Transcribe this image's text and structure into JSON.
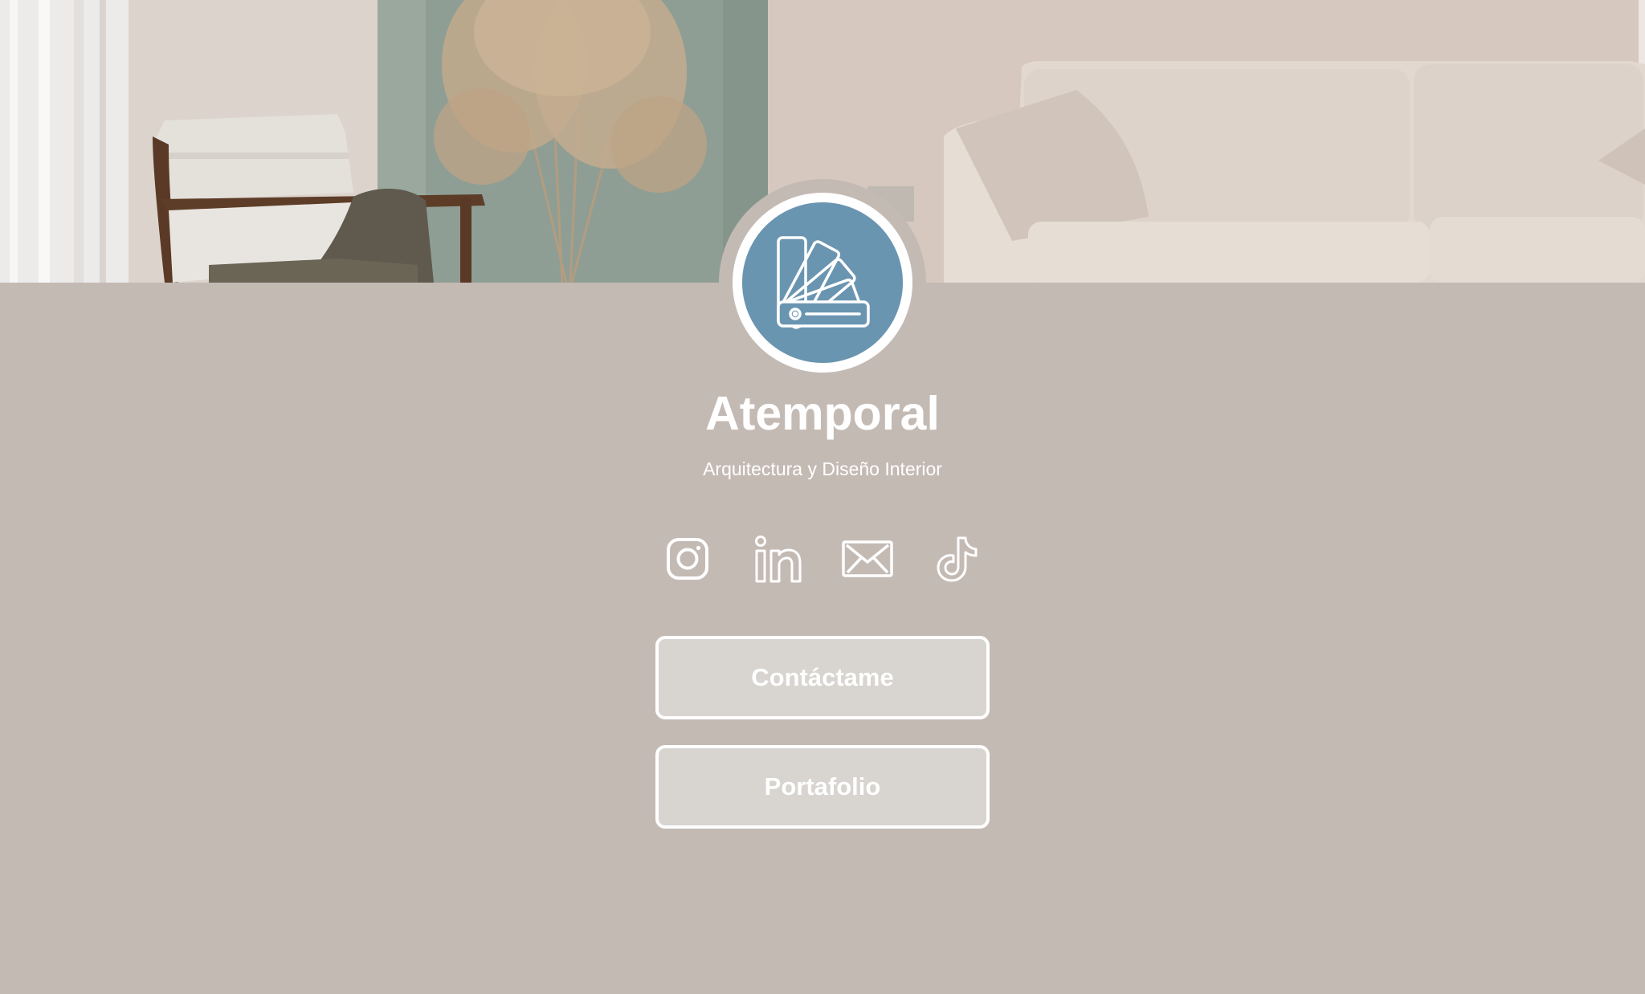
{
  "profile": {
    "name": "Atemporal",
    "tagline": "Arquitectura y Diseño Interior"
  },
  "socials": [
    {
      "icon": "instagram-icon"
    },
    {
      "icon": "linkedin-icon"
    },
    {
      "icon": "email-icon"
    },
    {
      "icon": "tiktok-icon"
    }
  ],
  "buttons": {
    "contact_label": "Contáctame",
    "portfolio_label": "Portafolio"
  },
  "avatar": {
    "icon": "color-swatch-fan-icon"
  },
  "colors": {
    "page_background": "#c4bab4",
    "avatar_background": "#6a95b1",
    "button_background": "#d8d4d0",
    "text": "#ffffff"
  }
}
